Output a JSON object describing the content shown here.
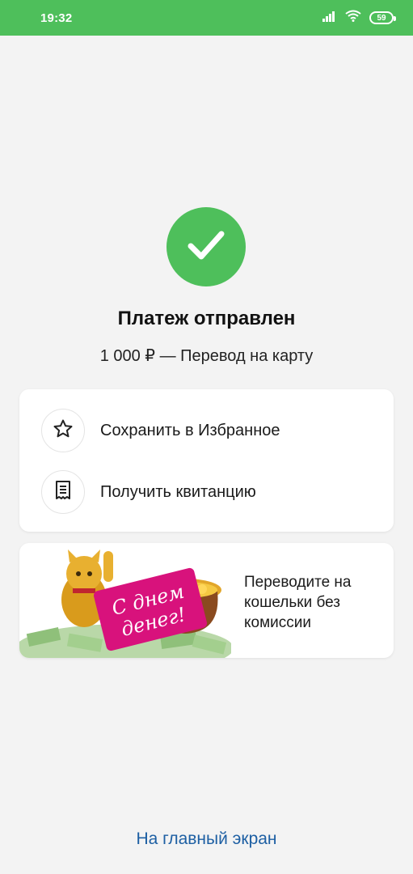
{
  "status_bar": {
    "time": "19:32",
    "battery": "59",
    "icons": [
      "signal-icon",
      "wifi-icon",
      "battery-icon"
    ],
    "color": "#4ebf5b"
  },
  "result": {
    "icon": "checkmark-icon",
    "title": "Платеж отправлен",
    "subtitle": "1 000 ₽ — Перевод на карту",
    "accent": "#4ebf5b"
  },
  "actions": [
    {
      "icon": "star-icon",
      "label": "Сохранить в Избранное"
    },
    {
      "icon": "receipt-icon",
      "label": "Получить квитанцию"
    }
  ],
  "promo": {
    "image_caption": "С днем денег!",
    "text": "Переводите на кошельки без комиссии"
  },
  "footer": {
    "home_link": "На главный экран",
    "link_color": "#1d5fa3"
  }
}
